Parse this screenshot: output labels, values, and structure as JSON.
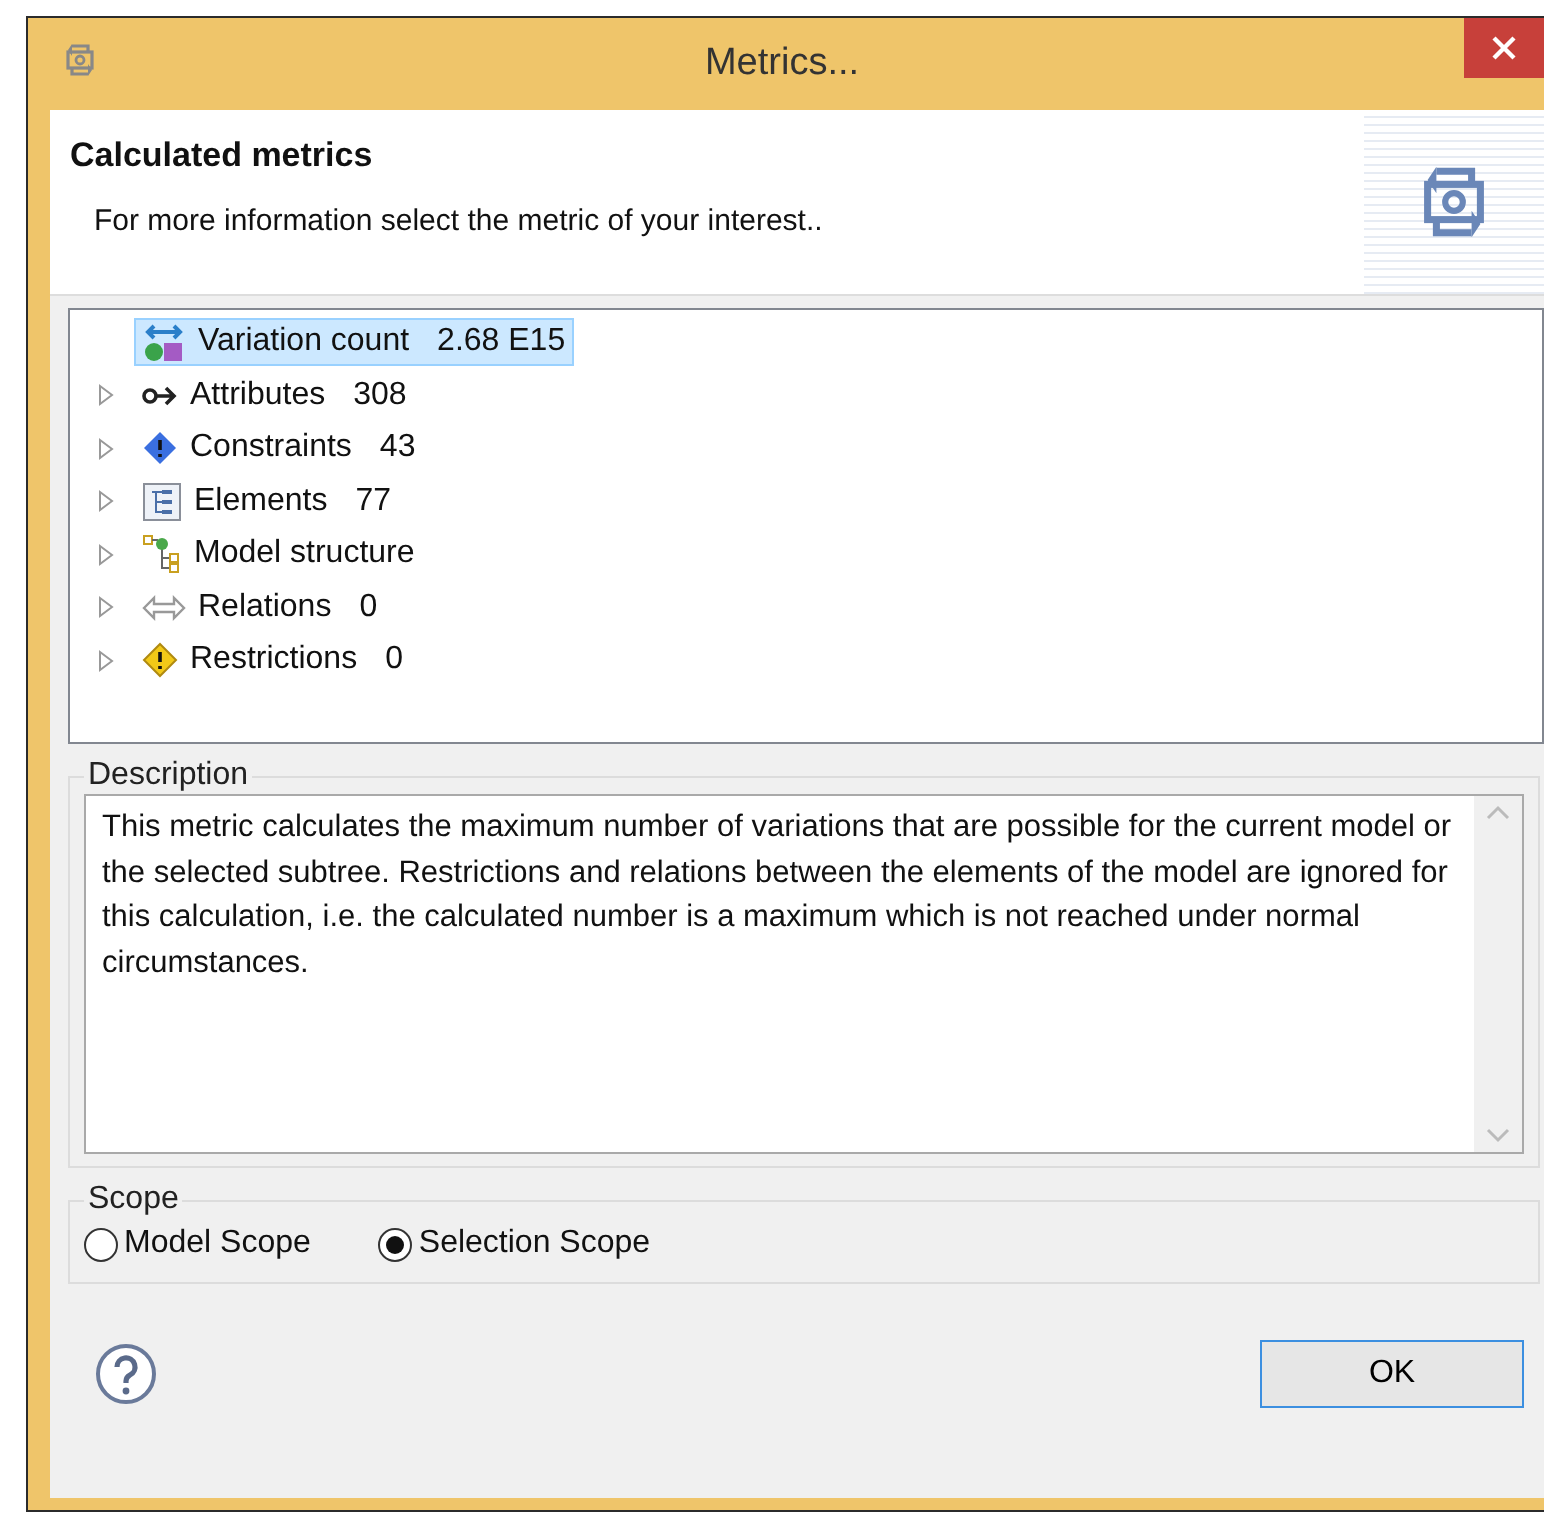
{
  "window": {
    "title": "Metrics..."
  },
  "header": {
    "title": "Calculated metrics",
    "subtitle": "For more information select the metric of your interest.."
  },
  "tree": {
    "items": [
      {
        "kind": "variation",
        "label": "Variation count",
        "value": "2.68 E15",
        "expandable": false,
        "selected": true
      },
      {
        "kind": "attributes",
        "label": "Attributes",
        "value": "308",
        "expandable": true,
        "selected": false
      },
      {
        "kind": "constraints",
        "label": "Constraints",
        "value": "43",
        "expandable": true,
        "selected": false
      },
      {
        "kind": "elements",
        "label": "Elements",
        "value": "77",
        "expandable": true,
        "selected": false
      },
      {
        "kind": "structure",
        "label": "Model structure",
        "expandable": true,
        "selected": false
      },
      {
        "kind": "relations",
        "label": "Relations",
        "value": "0",
        "expandable": true,
        "selected": false
      },
      {
        "kind": "restrictions",
        "label": "Restrictions",
        "value": "0",
        "expandable": true,
        "selected": false
      }
    ]
  },
  "description": {
    "title": "Description",
    "text": "This metric calculates the maximum number of variations that are possible for the current model or the selected subtree. Restrictions and relations between the elements of the model are ignored for this calculation, i.e. the calculated number is a maximum which is not reached under normal circumstances."
  },
  "scope": {
    "title": "Scope",
    "options": [
      {
        "label": "Model Scope",
        "selected": false
      },
      {
        "label": "Selection Scope",
        "selected": true
      }
    ]
  },
  "buttons": [
    "OK"
  ]
}
